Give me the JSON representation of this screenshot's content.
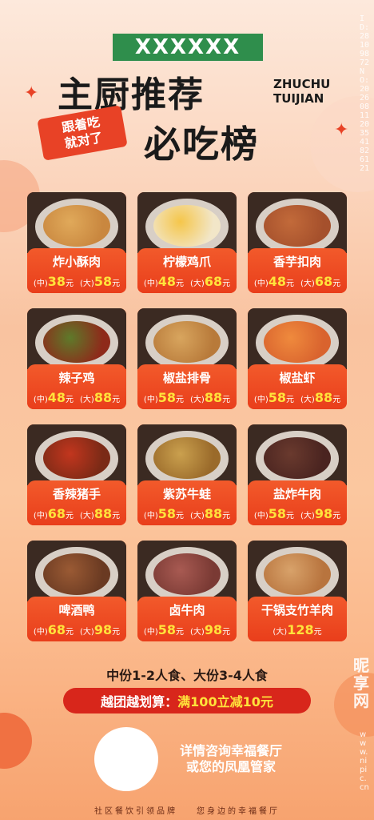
{
  "header": {
    "tag": "XXXXXX",
    "title": "主厨推荐",
    "title_en_line1": "ZHUCHU",
    "title_en_line2": "TUIJIAN",
    "subtitle": "必吃榜",
    "slogan_line1": "跟着吃",
    "slogan_line2": "就对了"
  },
  "labels": {
    "mid": "(中)",
    "large": "(大)",
    "unit": "元"
  },
  "dishes": [
    {
      "name": "炸小酥肉",
      "mid": "38",
      "large": "58"
    },
    {
      "name": "柠檬鸡爪",
      "mid": "48",
      "large": "68"
    },
    {
      "name": "香芋扣肉",
      "mid": "48",
      "large": "68"
    },
    {
      "name": "辣子鸡",
      "mid": "48",
      "large": "88"
    },
    {
      "name": "椒盐排骨",
      "mid": "58",
      "large": "88"
    },
    {
      "name": "椒盐虾",
      "mid": "58",
      "large": "88"
    },
    {
      "name": "香辣猪手",
      "mid": "68",
      "large": "88"
    },
    {
      "name": "紫苏牛蛙",
      "mid": "58",
      "large": "88"
    },
    {
      "name": "盐炸牛肉",
      "mid": "58",
      "large": "98"
    },
    {
      "name": "啤酒鸭",
      "mid": "68",
      "large": "98"
    },
    {
      "name": "卤牛肉",
      "mid": "58",
      "large": "98"
    },
    {
      "name": "干锅支竹羊肉",
      "large": "128"
    }
  ],
  "serving_note": "中份1-2人食、大份3-4人食",
  "promo": {
    "prefix": "越团越划算：",
    "highlight": "满100立减10元"
  },
  "contact": {
    "line1": "详情咨询幸福餐厅",
    "line2": "或您的凤凰管家"
  },
  "footer": {
    "left": "社区餐饮引领品牌",
    "right": "您身边的幸福餐厅"
  },
  "watermark": {
    "id": "ID:28109872 NO:20260811203541826121",
    "brand": "昵享网",
    "url": "www.nipic.cn"
  },
  "colors": {
    "accent": "#e84226",
    "tag_green": "#2f8e4c",
    "price_yellow": "#ffe33b"
  }
}
